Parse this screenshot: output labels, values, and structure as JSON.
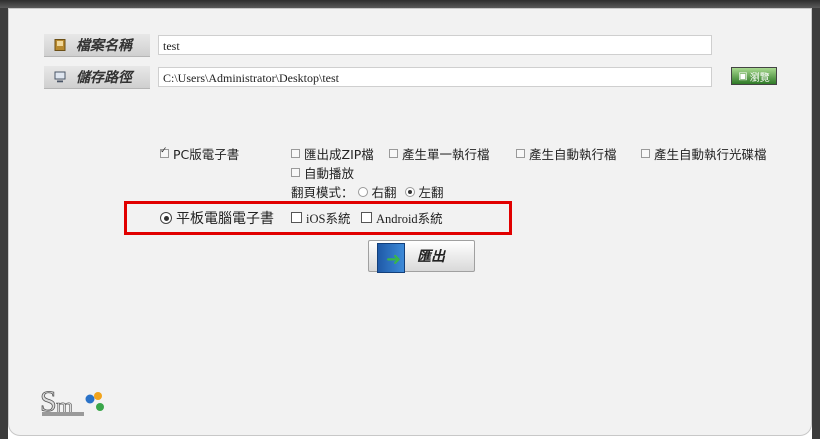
{
  "fields": {
    "filename_label": "檔案名稱",
    "filename_value": "test",
    "path_label": "儲存路徑",
    "path_value": "C:\\Users\\Administrator\\Desktop\\test",
    "browse_label": "瀏覽"
  },
  "pc_ebook": {
    "label": "PC版電子書",
    "checked": true,
    "options": {
      "zip": "匯出成ZIP檔",
      "single_exe": "產生單一執行檔",
      "auto_exe": "產生自動執行檔",
      "auto_cd": "產生自動執行光碟檔",
      "autoplay": "自動播放"
    },
    "page_mode_label": "翻頁模式：",
    "page_mode_right": "右翻",
    "page_mode_left": "左翻",
    "page_mode_selected": "左翻"
  },
  "tablet_ebook": {
    "label": "平板電腦電子書",
    "selected": true,
    "ios": "iOS系統",
    "android": "Android系統"
  },
  "export_label": "匯出",
  "colors": {
    "highlight": "#e10000",
    "browse": "#2f7a27",
    "book": "#1f5aa8"
  },
  "icons": {
    "filename": "file-icon",
    "path": "computer-icon",
    "export": "book-export-icon",
    "logo": "smmagic-logo"
  }
}
